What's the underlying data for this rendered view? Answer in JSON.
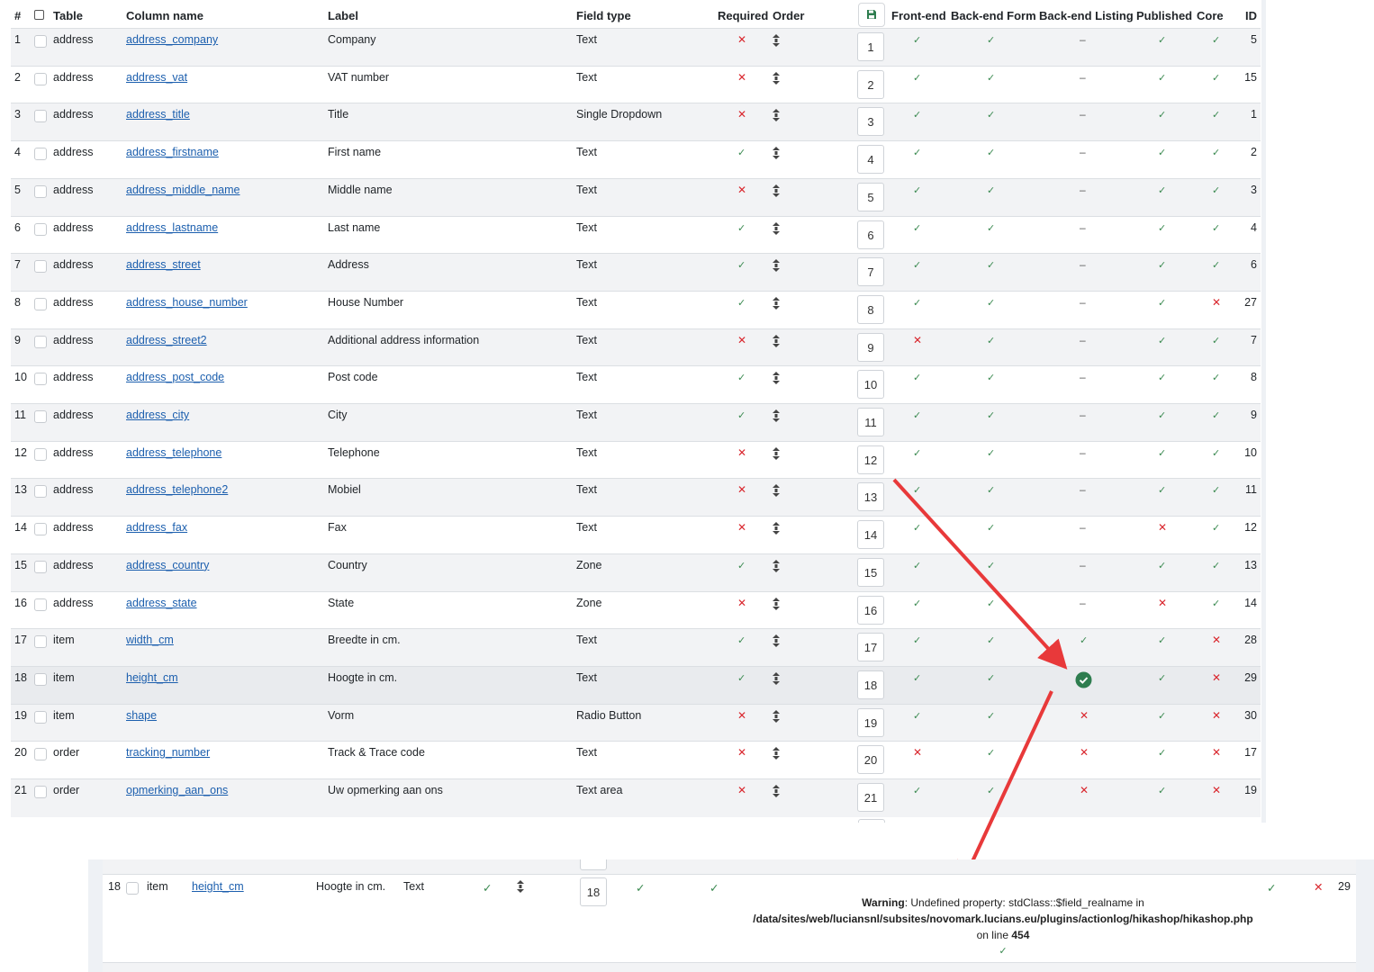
{
  "header": {
    "num": "#",
    "table": "Table",
    "column_name": "Column name",
    "label": "Label",
    "field_type": "Field type",
    "required": "Required",
    "order": "Order",
    "frontend": "Front-end",
    "backend_form": "Back-end Form",
    "backend_listing": "Back-end Listing",
    "published": "Published",
    "core": "Core",
    "id": "ID"
  },
  "colors": {
    "ok": "#3b8a51",
    "no": "#d9262d",
    "link": "#1c5fae",
    "arrow": "#e8393a",
    "highlight_check": "#2e7d4f"
  },
  "rows": [
    {
      "n": "1",
      "table": "address",
      "column": "address_company",
      "label": "Company",
      "type": "Text",
      "req": "no",
      "order": "1",
      "fe": "ok",
      "bf": "ok",
      "bl": "dash",
      "pub": "ok",
      "core": "ok",
      "id": "5"
    },
    {
      "n": "2",
      "table": "address",
      "column": "address_vat",
      "label": "VAT number",
      "type": "Text",
      "req": "no",
      "order": "2",
      "fe": "ok",
      "bf": "ok",
      "bl": "dash",
      "pub": "ok",
      "core": "ok",
      "id": "15"
    },
    {
      "n": "3",
      "table": "address",
      "column": "address_title",
      "label": "Title",
      "type": "Single Dropdown",
      "req": "no",
      "order": "3",
      "fe": "ok",
      "bf": "ok",
      "bl": "dash",
      "pub": "ok",
      "core": "ok",
      "id": "1"
    },
    {
      "n": "4",
      "table": "address",
      "column": "address_firstname",
      "label": "First name",
      "type": "Text",
      "req": "ok",
      "order": "4",
      "fe": "ok",
      "bf": "ok",
      "bl": "dash",
      "pub": "ok",
      "core": "ok",
      "id": "2"
    },
    {
      "n": "5",
      "table": "address",
      "column": "address_middle_name",
      "label": "Middle name",
      "type": "Text",
      "req": "no",
      "order": "5",
      "fe": "ok",
      "bf": "ok",
      "bl": "dash",
      "pub": "ok",
      "core": "ok",
      "id": "3"
    },
    {
      "n": "6",
      "table": "address",
      "column": "address_lastname",
      "label": "Last name",
      "type": "Text",
      "req": "ok",
      "order": "6",
      "fe": "ok",
      "bf": "ok",
      "bl": "dash",
      "pub": "ok",
      "core": "ok",
      "id": "4"
    },
    {
      "n": "7",
      "table": "address",
      "column": "address_street",
      "label": "Address",
      "type": "Text",
      "req": "ok",
      "order": "7",
      "fe": "ok",
      "bf": "ok",
      "bl": "dash",
      "pub": "ok",
      "core": "ok",
      "id": "6"
    },
    {
      "n": "8",
      "table": "address",
      "column": "address_house_number",
      "label": "House Number",
      "type": "Text",
      "req": "ok",
      "order": "8",
      "fe": "ok",
      "bf": "ok",
      "bl": "dash",
      "pub": "ok",
      "core": "no",
      "id": "27"
    },
    {
      "n": "9",
      "table": "address",
      "column": "address_street2",
      "label": "Additional address information",
      "type": "Text",
      "req": "no",
      "order": "9",
      "fe": "no",
      "bf": "ok",
      "bl": "dash",
      "pub": "ok",
      "core": "ok",
      "id": "7"
    },
    {
      "n": "10",
      "table": "address",
      "column": "address_post_code",
      "label": "Post code",
      "type": "Text",
      "req": "ok",
      "order": "10",
      "fe": "ok",
      "bf": "ok",
      "bl": "dash",
      "pub": "ok",
      "core": "ok",
      "id": "8"
    },
    {
      "n": "11",
      "table": "address",
      "column": "address_city",
      "label": "City",
      "type": "Text",
      "req": "ok",
      "order": "11",
      "fe": "ok",
      "bf": "ok",
      "bl": "dash",
      "pub": "ok",
      "core": "ok",
      "id": "9"
    },
    {
      "n": "12",
      "table": "address",
      "column": "address_telephone",
      "label": "Telephone",
      "type": "Text",
      "req": "no",
      "order": "12",
      "fe": "ok",
      "bf": "ok",
      "bl": "dash",
      "pub": "ok",
      "core": "ok",
      "id": "10"
    },
    {
      "n": "13",
      "table": "address",
      "column": "address_telephone2",
      "label": "Mobiel",
      "type": "Text",
      "req": "no",
      "order": "13",
      "fe": "ok",
      "bf": "ok",
      "bl": "dash",
      "pub": "ok",
      "core": "ok",
      "id": "11"
    },
    {
      "n": "14",
      "table": "address",
      "column": "address_fax",
      "label": "Fax",
      "type": "Text",
      "req": "no",
      "order": "14",
      "fe": "ok",
      "bf": "ok",
      "bl": "dash",
      "pub": "no",
      "core": "ok",
      "id": "12"
    },
    {
      "n": "15",
      "table": "address",
      "column": "address_country",
      "label": "Country",
      "type": "Zone",
      "req": "ok",
      "order": "15",
      "fe": "ok",
      "bf": "ok",
      "bl": "dash",
      "pub": "ok",
      "core": "ok",
      "id": "13"
    },
    {
      "n": "16",
      "table": "address",
      "column": "address_state",
      "label": "State",
      "type": "Zone",
      "req": "no",
      "order": "16",
      "fe": "ok",
      "bf": "ok",
      "bl": "dash",
      "pub": "no",
      "core": "ok",
      "id": "14"
    },
    {
      "n": "17",
      "table": "item",
      "column": "width_cm",
      "label": "Breedte in cm.",
      "type": "Text",
      "req": "ok",
      "order": "17",
      "fe": "ok",
      "bf": "ok",
      "bl": "ok",
      "pub": "ok",
      "core": "no",
      "id": "28"
    },
    {
      "n": "18",
      "table": "item",
      "column": "height_cm",
      "label": "Hoogte in cm.",
      "type": "Text",
      "req": "ok",
      "order": "18",
      "fe": "ok",
      "bf": "ok",
      "bl": "circle",
      "pub": "ok",
      "core": "no",
      "id": "29"
    },
    {
      "n": "19",
      "table": "item",
      "column": "shape",
      "label": "Vorm",
      "type": "Radio Button",
      "req": "no",
      "order": "19",
      "fe": "ok",
      "bf": "ok",
      "bl": "no",
      "pub": "ok",
      "core": "no",
      "id": "30"
    },
    {
      "n": "20",
      "table": "order",
      "column": "tracking_number",
      "label": "Track & Trace code",
      "type": "Text",
      "req": "no",
      "order": "20",
      "fe": "no",
      "bf": "ok",
      "bl": "no",
      "pub": "ok",
      "core": "no",
      "id": "17"
    },
    {
      "n": "21",
      "table": "order",
      "column": "opmerking_aan_ons",
      "label": "Uw opmerking aan ons",
      "type": "Text area",
      "req": "no",
      "order": "21",
      "fe": "ok",
      "bf": "ok",
      "bl": "no",
      "pub": "ok",
      "core": "no",
      "id": "19"
    }
  ],
  "inset": {
    "n": "18",
    "table": "item",
    "column": "height_cm",
    "label": "Hoogte in cm.",
    "type": "Text",
    "order": "18",
    "id": "29",
    "warning_label": "Warning",
    "warning_text": ": Undefined property: stdClass::$field_realname in",
    "warning_path": "/data/sites/web/luciansnl/subsites/novomark.lucians.eu/plugins/actionlog/hikashop/hikashop.php",
    "warning_line_prefix": "on line",
    "warning_line": "454"
  }
}
